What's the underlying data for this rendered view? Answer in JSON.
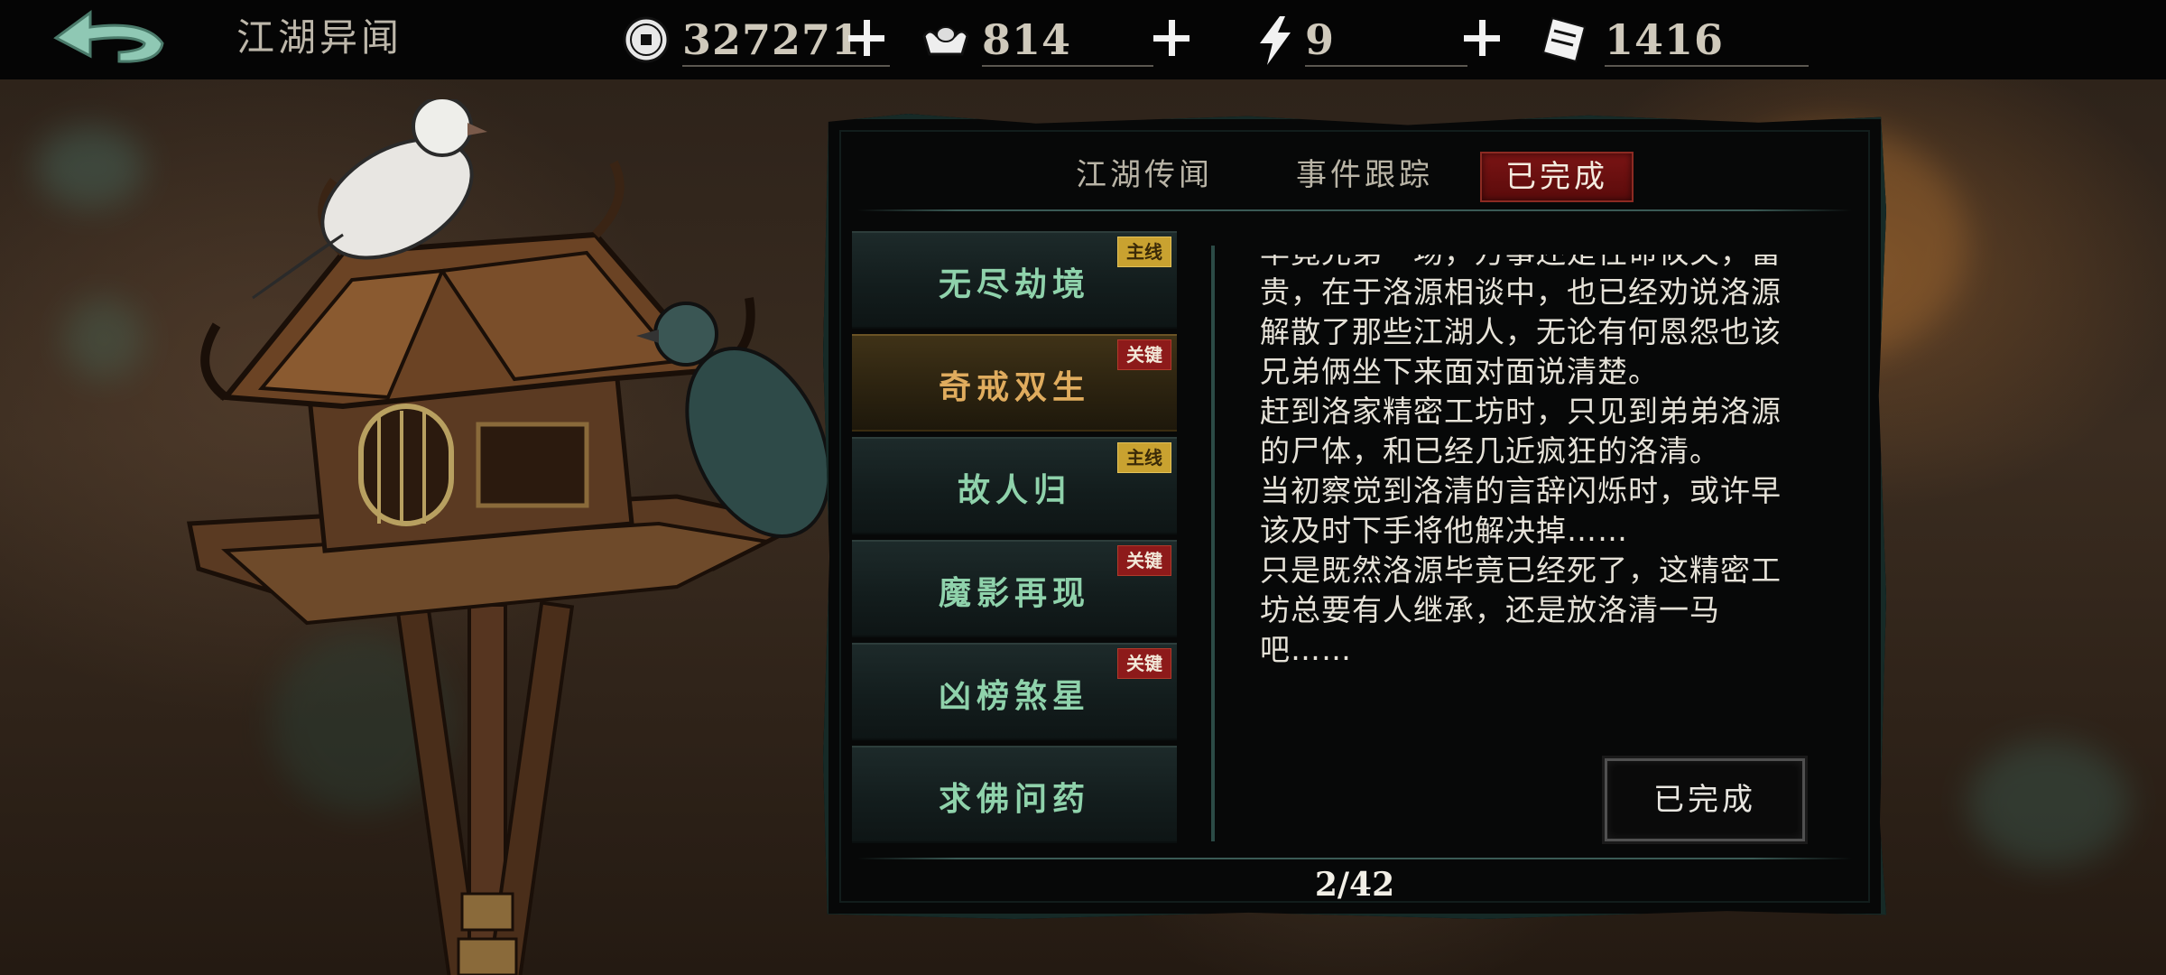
{
  "header": {
    "title": "江湖异闻"
  },
  "resources": [
    {
      "icon": "copper-coin-icon",
      "value": "327271"
    },
    {
      "icon": "silver-ingot-icon",
      "value": "814"
    },
    {
      "icon": "lightning-icon",
      "value": "9"
    },
    {
      "icon": "ticket-icon",
      "value": "1416"
    }
  ],
  "tabs": [
    {
      "label": "江湖传闻",
      "active": false
    },
    {
      "label": "事件跟踪",
      "active": false
    },
    {
      "label": "已完成",
      "active": true
    }
  ],
  "quests": [
    {
      "name": "无尽劫境",
      "badge": "主线",
      "badge_type": "main",
      "selected": false
    },
    {
      "name": "奇戒双生",
      "badge": "关键",
      "badge_type": "key",
      "selected": true
    },
    {
      "name": "故人归",
      "badge": "主线",
      "badge_type": "main",
      "selected": false
    },
    {
      "name": "魔影再现",
      "badge": "关键",
      "badge_type": "key",
      "selected": false
    },
    {
      "name": "凶榜煞星",
      "badge": "关键",
      "badge_type": "key",
      "selected": false
    },
    {
      "name": "求佛问药",
      "badge": "",
      "badge_type": "",
      "selected": false
    }
  ],
  "story": {
    "text": "毕竟兄弟一场，万事还是性命攸关，富贵，在于洛源相谈中，也已经劝说洛源解散了那些江湖人，无论有何恩怨也该兄弟俩坐下来面对面说清楚。\n赶到洛家精密工坊时，只见到弟弟洛源的尸体，和已经几近疯狂的洛清。\n当初察觉到洛清的言辞闪烁时，或许早该及时下手将他解决掉……\n只是既然洛源毕竟已经死了，这精密工坊总要有人继承，还是放洛清一马吧……"
  },
  "done_button": {
    "label": "已完成"
  },
  "pagination": {
    "text": "2/42"
  },
  "colors": {
    "accent_red": "#7a1414",
    "main_badge": "#c9a230",
    "key_badge": "#8d1a1a",
    "quest_text": "#8fd2ab",
    "selected_text": "#e0ac5e"
  }
}
